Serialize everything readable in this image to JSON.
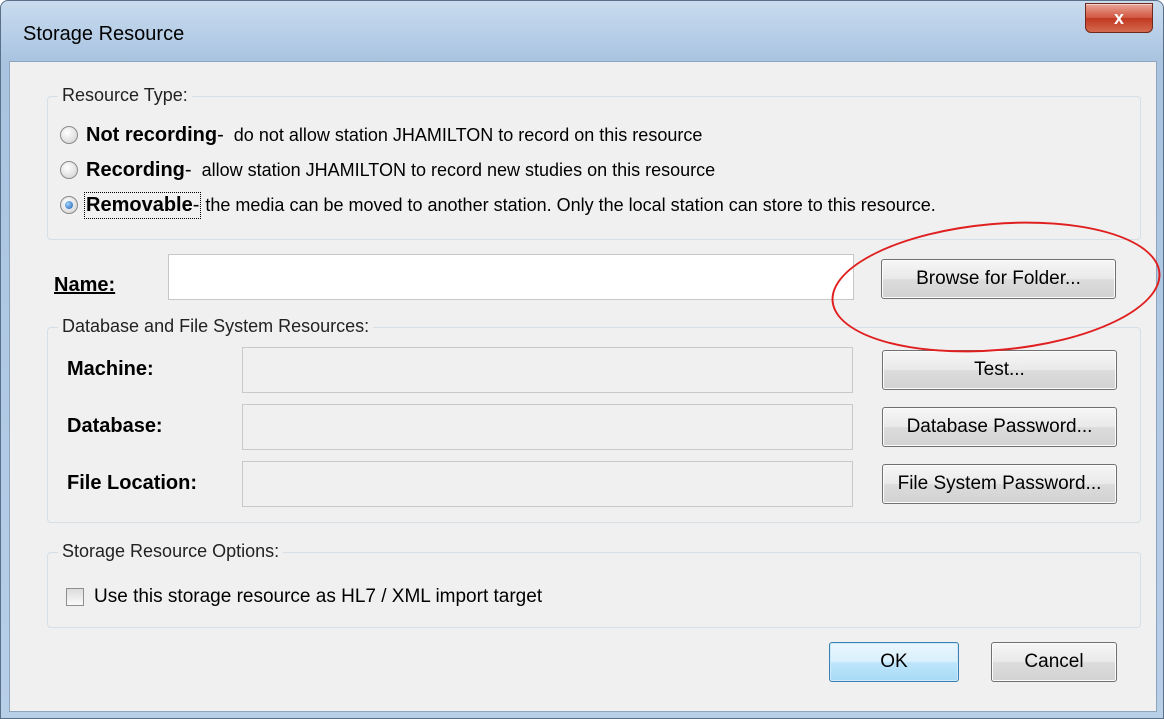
{
  "window": {
    "title": "Storage Resource",
    "close_glyph": "x"
  },
  "resource_type": {
    "group_title": "Resource Type:",
    "options": [
      {
        "label": "Not recording",
        "sep": " -",
        "desc": "do not allow station JHAMILTON to record on this resource",
        "checked": false
      },
      {
        "label": "Recording",
        "sep": " -",
        "desc": "allow station JHAMILTON to record new studies on this resource",
        "checked": false
      },
      {
        "label": "Removable",
        "sep": " -",
        "desc": "the media can be moved to another station.  Only the local station can store to this resource.",
        "checked": true
      }
    ]
  },
  "name": {
    "label": "Name:",
    "value": "",
    "browse_button": "Browse for Folder..."
  },
  "db_resources": {
    "group_title": "Database and File System Resources:",
    "machine_label": "Machine:",
    "machine_value": "",
    "test_button": "Test...",
    "database_label": "Database:",
    "database_value": "",
    "db_password_button": "Database Password...",
    "file_location_label": "File Location:",
    "file_location_value": "",
    "fs_password_button": "File System Password..."
  },
  "options": {
    "group_title": "Storage Resource Options:",
    "hl7_checkbox_label": "Use this storage resource as HL7 / XML import target",
    "hl7_checked": false
  },
  "footer": {
    "ok_button": "OK",
    "cancel_button": "Cancel"
  },
  "colors": {
    "annotation": "#e02020",
    "default_button_border": "#3c7fb1"
  }
}
